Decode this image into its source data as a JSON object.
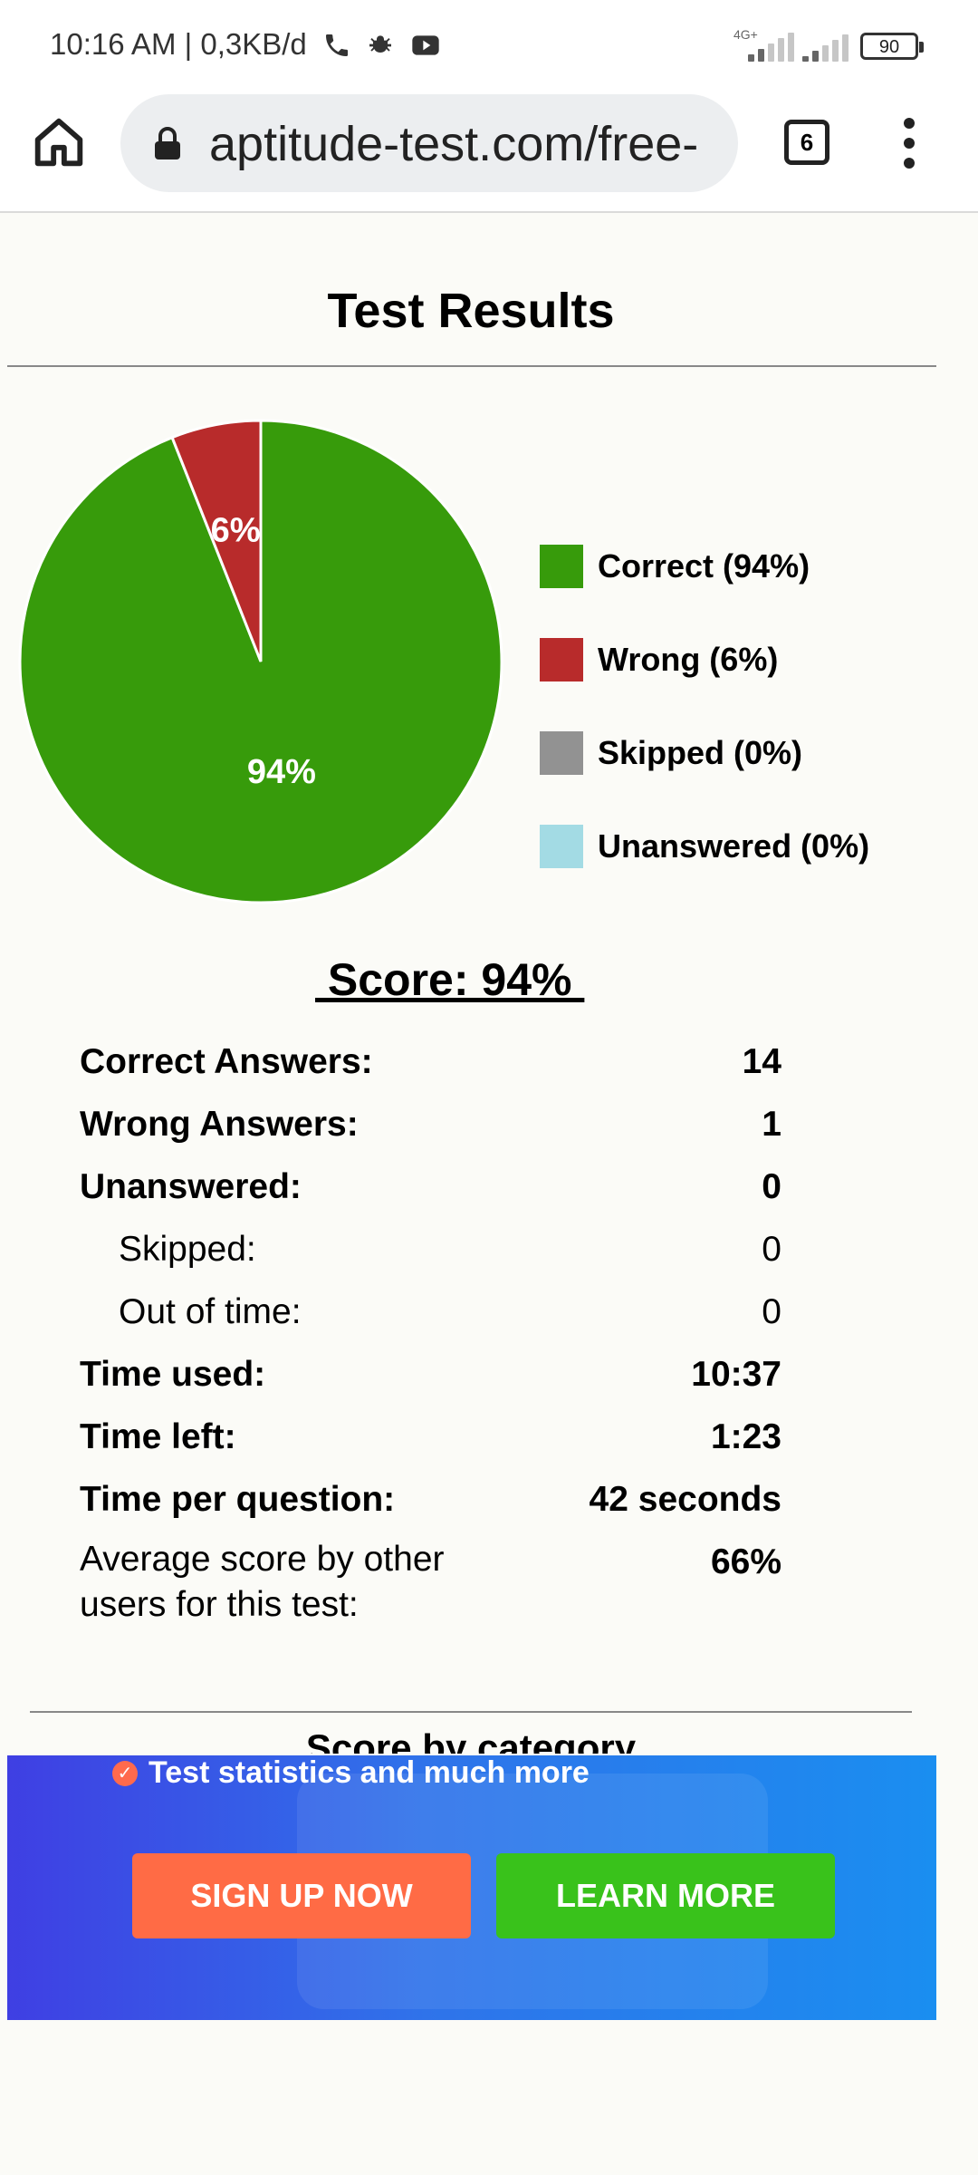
{
  "status_bar": {
    "time_net": "10:16 AM | 0,3KB/d",
    "network": "4G+",
    "battery": "90"
  },
  "browser": {
    "url": "aptitude-test.com/free-",
    "tab_count": "6"
  },
  "page": {
    "title": "Test Results",
    "score_title": " Score: 94% ",
    "category_heading": "Score by category"
  },
  "chart_data": {
    "type": "pie",
    "slices": [
      {
        "label": "Correct (94%)",
        "value": 94,
        "color": "#379b0b",
        "data_label": "94%"
      },
      {
        "label": "Wrong (6%)",
        "value": 6,
        "color": "#b82b2b",
        "data_label": "6%"
      },
      {
        "label": "Skipped (0%)",
        "value": 0,
        "color": "#929292",
        "data_label": ""
      },
      {
        "label": "Unanswered (0%)",
        "value": 0,
        "color": "#a3dbe4",
        "data_label": ""
      }
    ],
    "legend_position": "right"
  },
  "stats": [
    {
      "label": "Correct Answers:",
      "value": "14",
      "bold": true
    },
    {
      "label": "Wrong Answers:",
      "value": "1",
      "bold": true
    },
    {
      "label": "Unanswered:",
      "value": "0",
      "bold": true
    },
    {
      "label": "Skipped:",
      "value": "0",
      "bold": false,
      "indent": true
    },
    {
      "label": "Out of time:",
      "value": "0",
      "bold": false,
      "indent": true
    },
    {
      "label": "Time used:",
      "value": "10:37",
      "bold": true
    },
    {
      "label": "Time left:",
      "value": "1:23",
      "bold": true
    },
    {
      "label": "Time per question:",
      "value": "42 seconds",
      "bold": true
    },
    {
      "label": "Average score by other users for this test:",
      "value": "66%",
      "bold": false,
      "value_bold": true
    }
  ],
  "banner": {
    "promo_text": "Test statistics and much more",
    "signup_label": "SIGN UP NOW",
    "learn_label": "LEARN MORE"
  }
}
